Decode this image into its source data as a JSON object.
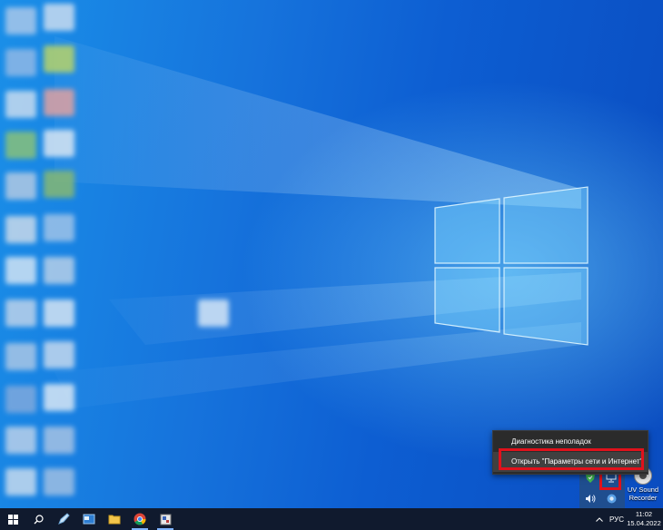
{
  "context_menu": {
    "items": [
      {
        "label": "Диагностика неполадок"
      },
      {
        "label": "Открыть \"Параметры сети и Интернет\""
      }
    ]
  },
  "desktop": {
    "uv_recorder_label_line1": "UV Sound",
    "uv_recorder_label_line2": "Recorder"
  },
  "taskbar": {
    "items": [
      "windows-start",
      "search",
      "pen-app",
      "window-app",
      "file-explorer",
      "chrome",
      "store-app"
    ],
    "language": "РУС",
    "time": "11:02",
    "date": "15.04.2022",
    "tray_flyout_icons": [
      "shield-icon",
      "network-icon",
      "volume-icon",
      "app-icon"
    ]
  },
  "colors": {
    "highlight_red": "#e0121c",
    "taskbar_bg": "#101a2e",
    "menu_bg": "#2b2b2b"
  }
}
